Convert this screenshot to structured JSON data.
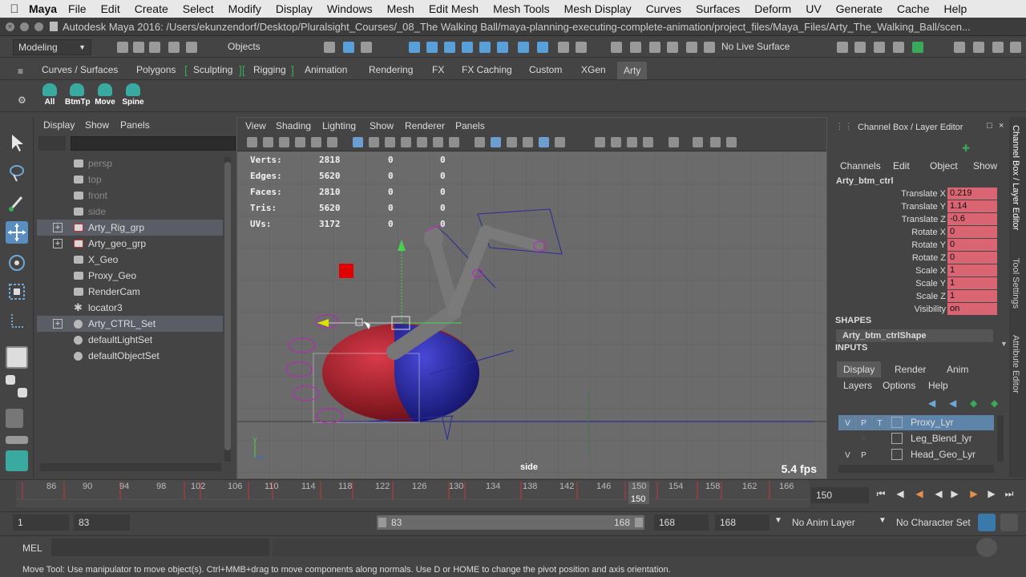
{
  "macbar": {
    "app": "Maya",
    "menus": [
      "File",
      "Edit",
      "Create",
      "Select",
      "Modify",
      "Display",
      "Windows",
      "Mesh",
      "Edit Mesh",
      "Mesh Tools",
      "Mesh Display",
      "Curves",
      "Surfaces",
      "Deform",
      "UV",
      "Generate",
      "Cache",
      "Help"
    ]
  },
  "window": {
    "title": "Autodesk Maya 2016: /Users/ekunzendorf/Desktop/Pluralsight_Courses/_08_The Walking Ball/maya-planning-executing-complete-animation/project_files/Maya_Files/Arty_The_Walking_Ball/scen..."
  },
  "toolbar": {
    "menuset": "Modeling",
    "selection_mode": "Objects",
    "live_surface": "No Live Surface"
  },
  "shelf": {
    "tabs": [
      "Curves / Surfaces",
      "Polygons",
      "Sculpting",
      "Rigging",
      "Animation",
      "Rendering",
      "FX",
      "FX Caching",
      "Custom",
      "XGen",
      "Arty"
    ],
    "active_tab": "Arty",
    "buttons": [
      "All",
      "BtmTp",
      "Move",
      "Spine"
    ]
  },
  "outliner": {
    "menus": [
      "Display",
      "Show",
      "Panels"
    ],
    "rows": [
      {
        "label": "persp",
        "dim": true,
        "expand": false
      },
      {
        "label": "top",
        "dim": true,
        "expand": false
      },
      {
        "label": "front",
        "dim": true,
        "expand": false
      },
      {
        "label": "side",
        "dim": true,
        "expand": false
      },
      {
        "label": "Arty_Rig_grp",
        "dim": false,
        "expand": true,
        "selected": true
      },
      {
        "label": "Arty_geo_grp",
        "dim": false,
        "expand": true
      },
      {
        "label": "X_Geo",
        "dim": false,
        "expand": false
      },
      {
        "label": "Proxy_Geo",
        "dim": false,
        "expand": false
      },
      {
        "label": "RenderCam",
        "dim": false,
        "expand": false
      },
      {
        "label": "locator3",
        "dim": false,
        "expand": false
      },
      {
        "label": "Arty_CTRL_Set",
        "dim": false,
        "expand": true,
        "selected": true
      },
      {
        "label": "defaultLightSet",
        "dim": false,
        "expand": false
      },
      {
        "label": "defaultObjectSet",
        "dim": false,
        "expand": false
      }
    ],
    "expand_symbol": "+"
  },
  "viewport": {
    "menus": [
      "View",
      "Shading",
      "Lighting",
      "Show",
      "Renderer",
      "Panels"
    ],
    "hud": [
      {
        "label": "Verts:",
        "v1": "2818",
        "v2": "0",
        "v3": "0"
      },
      {
        "label": "Edges:",
        "v1": "5620",
        "v2": "0",
        "v3": "0"
      },
      {
        "label": "Faces:",
        "v1": "2810",
        "v2": "0",
        "v3": "0"
      },
      {
        "label": "Tris:",
        "v1": "5620",
        "v2": "0",
        "v3": "0"
      },
      {
        "label": "UVs:",
        "v1": "3172",
        "v2": "0",
        "v3": "0"
      }
    ],
    "camera": "side",
    "fps": "5.4 fps"
  },
  "channelbox": {
    "title": "Channel Box / Layer Editor",
    "menus": [
      "Channels",
      "Edit",
      "Object",
      "Show"
    ],
    "object": "Arty_btm_ctrl",
    "attributes": [
      {
        "name": "Translate X",
        "value": "0.219"
      },
      {
        "name": "Translate Y",
        "value": "1.14"
      },
      {
        "name": "Translate Z",
        "value": "-0.6"
      },
      {
        "name": "Rotate X",
        "value": "0"
      },
      {
        "name": "Rotate Y",
        "value": "0"
      },
      {
        "name": "Rotate Z",
        "value": "0"
      },
      {
        "name": "Scale X",
        "value": "1"
      },
      {
        "name": "Scale Y",
        "value": "1"
      },
      {
        "name": "Scale Z",
        "value": "1"
      },
      {
        "name": "Visibility",
        "value": "on"
      }
    ],
    "shapes_header": "SHAPES",
    "shape_name": "Arty_btm_ctrlShape",
    "inputs_header": "INPUTS"
  },
  "layereditor": {
    "tabs": [
      "Display",
      "Render",
      "Anim"
    ],
    "menus": [
      "Layers",
      "Options",
      "Help"
    ],
    "layers": [
      {
        "v": "V",
        "p": "P",
        "t": "T",
        "name": "Proxy_Lyr"
      },
      {
        "v": "",
        "p": "P",
        "t": "",
        "name": "Leg_Blend_lyr"
      },
      {
        "v": "V",
        "p": "P",
        "t": "",
        "name": "Head_Geo_Lyr"
      }
    ]
  },
  "sidetabs": [
    "Channel Box / Layer Editor",
    "Tool Settings",
    "Attribute Editor"
  ],
  "timeslider": {
    "ticks": [
      "86",
      "90",
      "94",
      "98",
      "102",
      "106",
      "110",
      "114",
      "118",
      "122",
      "126",
      "130",
      "134",
      "138",
      "142",
      "146",
      "150",
      "154",
      "158",
      "162",
      "166"
    ],
    "current": "150",
    "current_box": "150"
  },
  "rangeslider": {
    "start": "1",
    "range_start": "83",
    "bar_start": "83",
    "bar_end": "168",
    "range_end": "168",
    "end": "168",
    "anim_layer": "No Anim Layer",
    "character_set": "No Character Set"
  },
  "cmdline": {
    "label": "MEL"
  },
  "helpline": "Move Tool: Use manipulator to move object(s). Ctrl+MMB+drag to move components along normals. Use D or HOME to change the pivot position and axis orientation.",
  "colors": {
    "attr_keyed": "#d96472",
    "selection_blue": "#5f84aa",
    "ball_red": "#a81e2a",
    "ball_blue": "#2a2aa8",
    "current_time": "#e8e8e8"
  }
}
